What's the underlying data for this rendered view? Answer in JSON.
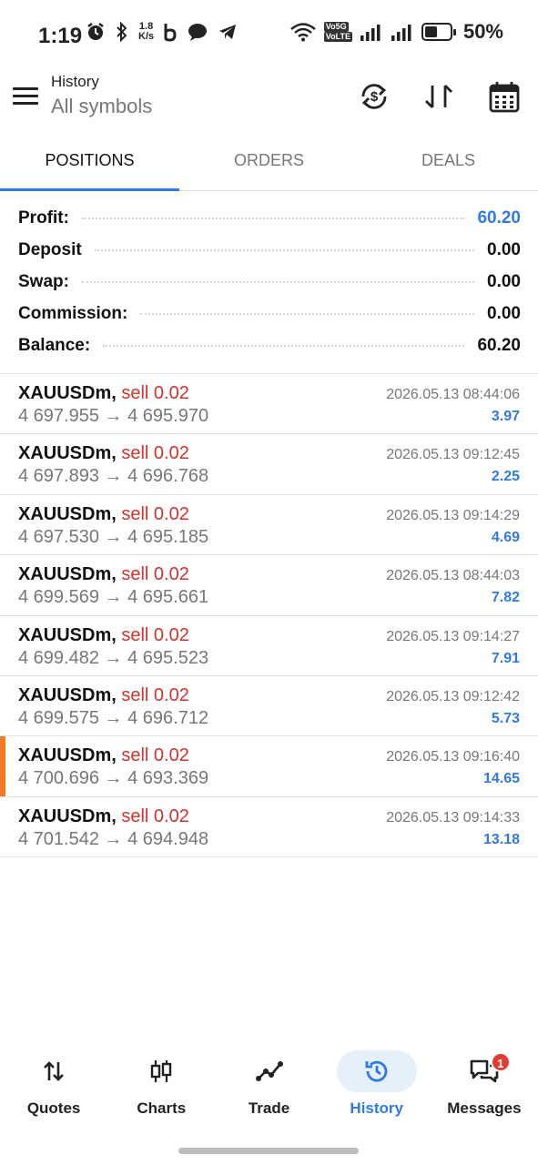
{
  "status_bar": {
    "time": "1:19",
    "speed_value": "1.8",
    "speed_unit": "K/s",
    "vo5g": "Vo5G",
    "volte": "VoLTE",
    "battery": "50%"
  },
  "header": {
    "title": "History",
    "subtitle": "All symbols"
  },
  "tabs": [
    {
      "label": "POSITIONS",
      "active": true
    },
    {
      "label": "ORDERS",
      "active": false
    },
    {
      "label": "DEALS",
      "active": false
    }
  ],
  "summary": {
    "profit_label": "Profit:",
    "profit_value": "60.20",
    "deposit_label": "Deposit",
    "deposit_value": "0.00",
    "swap_label": "Swap:",
    "swap_value": "0.00",
    "commission_label": "Commission:",
    "commission_value": "0.00",
    "balance_label": "Balance:",
    "balance_value": "60.20"
  },
  "deals": [
    {
      "symbol": "XAUUSDm,",
      "side": "sell 0.02",
      "prices": "4 697.955 → 4 695.970",
      "time": "2026.05.13 08:44:06",
      "profit": "3.97"
    },
    {
      "symbol": "XAUUSDm,",
      "side": "sell 0.02",
      "prices": "4 697.893 → 4 696.768",
      "time": "2026.05.13 09:12:45",
      "profit": "2.25"
    },
    {
      "symbol": "XAUUSDm,",
      "side": "sell 0.02",
      "prices": "4 697.530 → 4 695.185",
      "time": "2026.05.13 09:14:29",
      "profit": "4.69"
    },
    {
      "symbol": "XAUUSDm,",
      "side": "sell 0.02",
      "prices": "4 699.569 → 4 695.661",
      "time": "2026.05.13 08:44:03",
      "profit": "7.82"
    },
    {
      "symbol": "XAUUSDm,",
      "side": "sell 0.02",
      "prices": "4 699.482 → 4 695.523",
      "time": "2026.05.13 09:14:27",
      "profit": "7.91"
    },
    {
      "symbol": "XAUUSDm,",
      "side": "sell 0.02",
      "prices": "4 699.575 → 4 696.712",
      "time": "2026.05.13 09:12:42",
      "profit": "5.73"
    },
    {
      "symbol": "XAUUSDm,",
      "side": "sell 0.02",
      "prices": "4 700.696 → 4 693.369",
      "time": "2026.05.13 09:16:40",
      "profit": "14.65"
    },
    {
      "symbol": "XAUUSDm,",
      "side": "sell 0.02",
      "prices": "4 701.542 → 4 694.948",
      "time": "2026.05.13 09:14:33",
      "profit": "13.18"
    }
  ],
  "bottom_nav": [
    {
      "label": "Quotes",
      "icon": "quotes-icon"
    },
    {
      "label": "Charts",
      "icon": "charts-icon"
    },
    {
      "label": "Trade",
      "icon": "trade-icon"
    },
    {
      "label": "History",
      "icon": "history-icon",
      "active": true
    },
    {
      "label": "Messages",
      "icon": "messages-icon",
      "badge": "1"
    }
  ],
  "colors": {
    "accent": "#2f7ae5",
    "sell": "#d3322c",
    "highlight": "#f07b22"
  }
}
